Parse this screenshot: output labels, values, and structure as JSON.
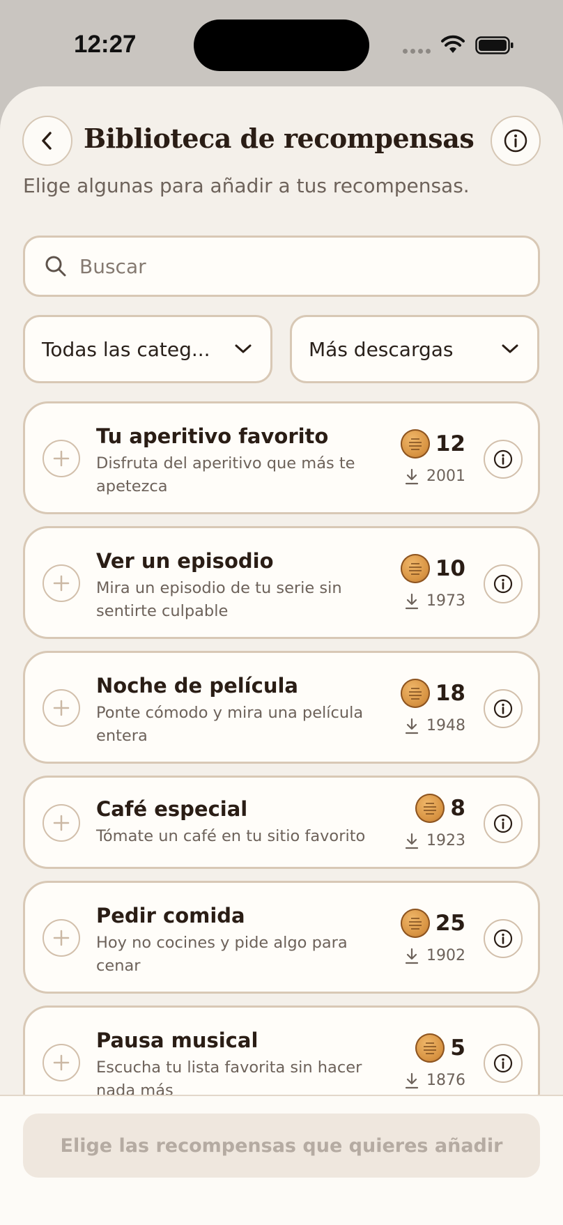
{
  "status_bar": {
    "time": "12:27"
  },
  "header": {
    "title": "Biblioteca de recompensas",
    "subtitle": "Elige algunas para añadir a tus recompensas."
  },
  "search": {
    "placeholder": "Buscar",
    "value": ""
  },
  "filters": {
    "category": "Todas las categ...",
    "sort": "Más descargas"
  },
  "rewards": [
    {
      "title": "Tu aperitivo favorito",
      "description": "Disfruta del aperitivo que más te apetezca",
      "coins": "12",
      "downloads": "2001"
    },
    {
      "title": "Ver un episodio",
      "description": "Mira un episodio de tu serie sin sentirte culpable",
      "coins": "10",
      "downloads": "1973"
    },
    {
      "title": "Noche de película",
      "description": "Ponte cómodo y mira una película entera",
      "coins": "18",
      "downloads": "1948"
    },
    {
      "title": "Café especial",
      "description": "Tómate un café en tu sitio favorito",
      "coins": "8",
      "downloads": "1923"
    },
    {
      "title": "Pedir comida",
      "description": "Hoy no cocines y pide algo para cenar",
      "coins": "25",
      "downloads": "1902"
    },
    {
      "title": "Pausa musical",
      "description": "Escucha tu lista favorita sin hacer nada más",
      "coins": "5",
      "downloads": "1876"
    }
  ],
  "footer": {
    "primary_button": "Elige las recompensas que quieres añadir"
  },
  "colors": {
    "background": "#f4f0ea",
    "card": "#fffdf9",
    "border": "#d8c8b5",
    "coin": "#d89443",
    "disabled_button": "#efe7de"
  },
  "icons": [
    "back-icon",
    "info-icon",
    "search-icon",
    "chevron-down-icon",
    "plus-icon",
    "coin-icon",
    "download-icon",
    "wifi-icon",
    "battery-icon"
  ]
}
